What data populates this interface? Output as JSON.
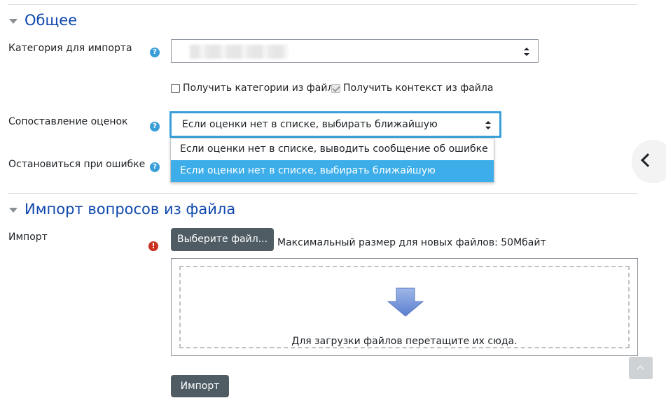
{
  "sections": {
    "general": {
      "title": "Общее"
    },
    "import_file": {
      "title": "Импорт вопросов из файла"
    }
  },
  "form": {
    "category": {
      "label": "Категория для импорта",
      "value": ""
    },
    "checkbox_category_from_file": {
      "label": "Получить категории из файла",
      "checked": false
    },
    "checkbox_context_from_file": {
      "label": "Получить контекст из файла",
      "checked": true,
      "disabled": true
    },
    "grade_matching": {
      "label": "Сопоставление оценок",
      "value": "Если оценки нет в списке, выбирать ближайшую",
      "options": [
        "Если оценки нет в списке, выводить сообщение об ошибке",
        "Если оценки нет в списке, выбирать ближайшую"
      ],
      "highlighted_index": 1
    },
    "stop_on_error": {
      "label": "Остановиться при ошибке"
    },
    "import": {
      "label": "Импорт",
      "choose_button": "Выберите файл...",
      "max_size_text": "Максимальный размер для новых файлов: 50Мбайт",
      "dropzone_text": "Для загрузки файлов перетащите их сюда."
    },
    "submit_button": "Импорт"
  },
  "icons": {
    "help": "question-circle-icon",
    "required": "exclamation-circle-icon",
    "drawer_toggle": "chevron-left-icon",
    "back_to_top": "arrow-up-icon",
    "dropzone_arrow": "arrow-down-icon"
  },
  "colors": {
    "heading": "#0f47ad",
    "help_icon": "#3a9fd8",
    "required_icon": "#ca3120",
    "button": "#4f5c64",
    "option_highlight": "#3daee9",
    "focus_border": "#3a9fd8"
  }
}
